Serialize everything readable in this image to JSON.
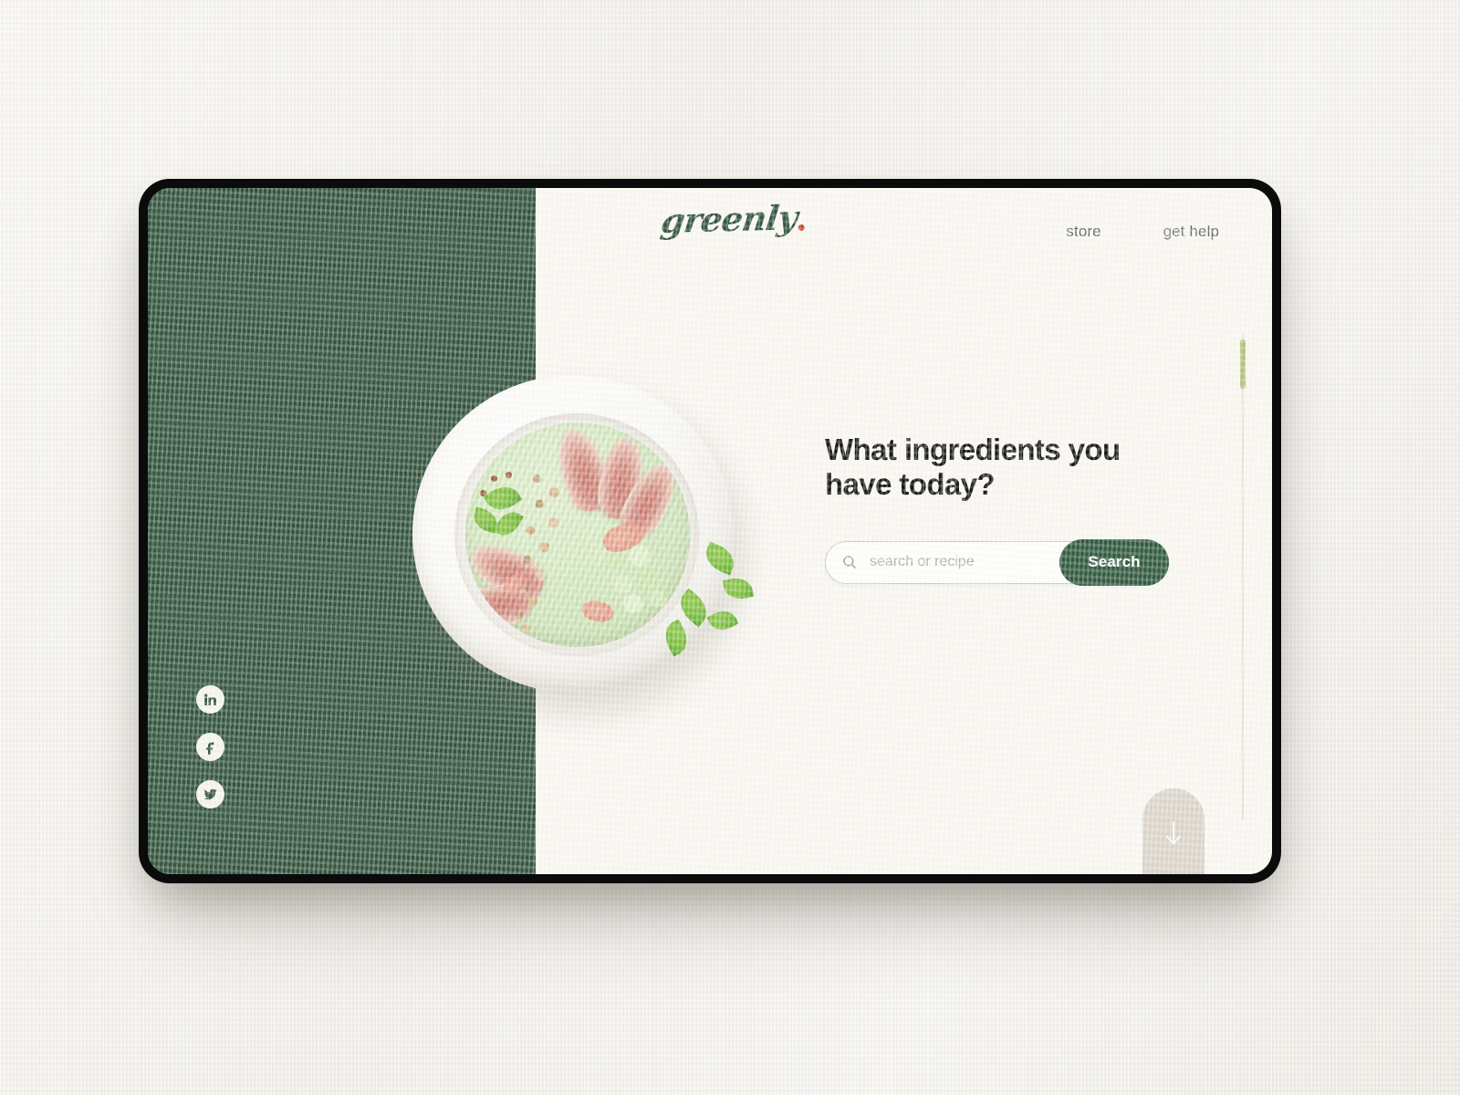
{
  "brand": {
    "logo_text": "greenly",
    "logo_dot": "•",
    "logo_color": "#2f5340",
    "dot_color": "#c8442f"
  },
  "nav": {
    "items": [
      {
        "label": "store"
      },
      {
        "label": "get help"
      }
    ]
  },
  "hero": {
    "headline": "What ingredients you\nhave today?",
    "image_alt": "green smoothie bowl with fig slices, granola and cucumber on a white plate"
  },
  "search": {
    "placeholder": "search or recipe",
    "value": "",
    "button_label": "Search",
    "icon": "search-icon",
    "button_color": "#2f5a3f"
  },
  "social": {
    "items": [
      {
        "name": "linkedin",
        "label": "LinkedIn"
      },
      {
        "name": "facebook",
        "label": "Facebook"
      },
      {
        "name": "twitter",
        "label": "Twitter"
      }
    ]
  },
  "scroll": {
    "arrow_icon": "arrow-down-icon",
    "thumb_color": "#b2c47c",
    "tab_color": "#dcd6cc"
  },
  "theme": {
    "panel_green": "#32563f",
    "page_bg": "#faf8f3",
    "backdrop": "#f2f0eb",
    "bezel": "#0b0b0b"
  }
}
